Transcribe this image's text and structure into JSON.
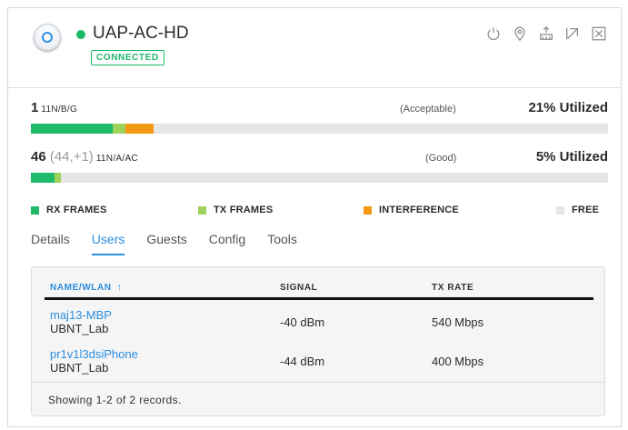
{
  "device": {
    "name": "UAP-AC-HD",
    "status": "CONNECTED",
    "status_color": "#1fb96a",
    "header_icons": [
      "power-icon",
      "locate-pin-icon",
      "network-uplink-icon",
      "open-external-icon",
      "close-icon"
    ]
  },
  "radios": [
    {
      "channel": "1",
      "channel_detail": "",
      "mode": "11N/B/G",
      "quality": "(Acceptable)",
      "utilization": "21% Utilized",
      "bar": {
        "rx": 0.141,
        "tx": 0.022,
        "interference": 0.05
      }
    },
    {
      "channel": "46",
      "channel_detail": " (44,+1)",
      "mode": "11N/A/AC",
      "quality": "(Good)",
      "utilization": "5% Utilized",
      "bar": {
        "rx": 0.041,
        "tx": 0.011,
        "interference": 0
      }
    }
  ],
  "legend": {
    "rx": {
      "label": "RX FRAMES",
      "color": "#1fb96a"
    },
    "tx": {
      "label": "TX FRAMES",
      "color": "#9ed35b"
    },
    "interference": {
      "label": "INTERFERENCE",
      "color": "#f39a14"
    },
    "free": {
      "label": "FREE",
      "color": "#e6e6e6"
    }
  },
  "tabs": [
    {
      "label": "Details",
      "active": false
    },
    {
      "label": "Users",
      "active": true
    },
    {
      "label": "Guests",
      "active": false
    },
    {
      "label": "Config",
      "active": false
    },
    {
      "label": "Tools",
      "active": false
    }
  ],
  "table": {
    "headers": {
      "name": "NAME/WLAN",
      "sort_icon": "↑",
      "signal": "SIGNAL",
      "tx_rate": "TX RATE"
    },
    "rows": [
      {
        "host": "maj13-MBP",
        "wlan": "UBNT_Lab",
        "signal": "-40 dBm",
        "tx_rate": "540 Mbps"
      },
      {
        "host": "pr1v1l3dsiPhone",
        "wlan": "UBNT_Lab",
        "signal": "-44 dBm",
        "tx_rate": "400 Mbps"
      }
    ],
    "footer": "Showing 1-2 of 2 records."
  }
}
